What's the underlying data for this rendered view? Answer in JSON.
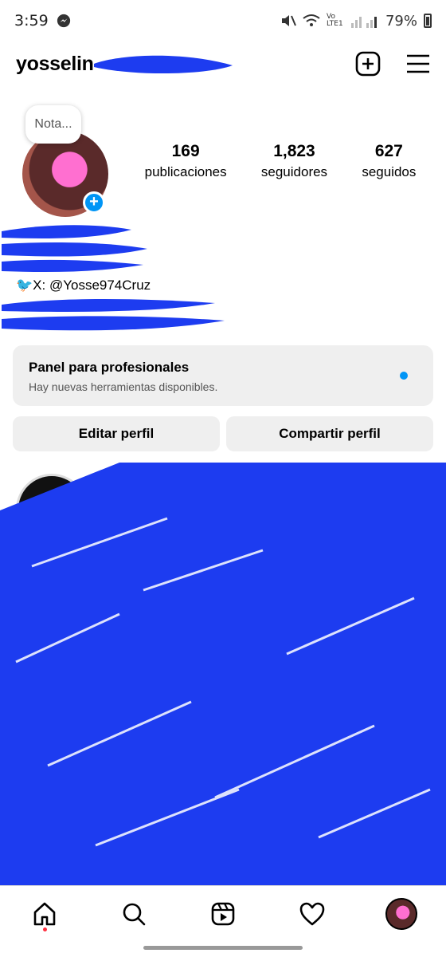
{
  "status_bar": {
    "time": "3:59",
    "network": "Vo LTE1",
    "battery": "79%"
  },
  "header": {
    "username": "yosselin",
    "icons": [
      "new-post-icon",
      "menu-icon"
    ]
  },
  "profile": {
    "note_placeholder": "Nota...",
    "stats": [
      {
        "value": "169",
        "label": "publicaciones"
      },
      {
        "value": "1,823",
        "label": "seguidores"
      },
      {
        "value": "627",
        "label": "seguidos"
      }
    ],
    "bio_visible": "🐦X: @Yosse974Cruz"
  },
  "pro_panel": {
    "title": "Panel para profesionales",
    "subtitle": "Hay nuevas herramientas disponibles.",
    "accent": "#0095f6"
  },
  "actions": {
    "edit": "Editar perfil",
    "share": "Compartir perfil"
  },
  "colors": {
    "redaction": "#1d3cf0",
    "button_bg": "#efefef",
    "badge": "#0095f6"
  },
  "bottom_nav": {
    "items": [
      "home-icon",
      "search-icon",
      "reels-icon",
      "heart-icon",
      "profile-avatar"
    ]
  }
}
